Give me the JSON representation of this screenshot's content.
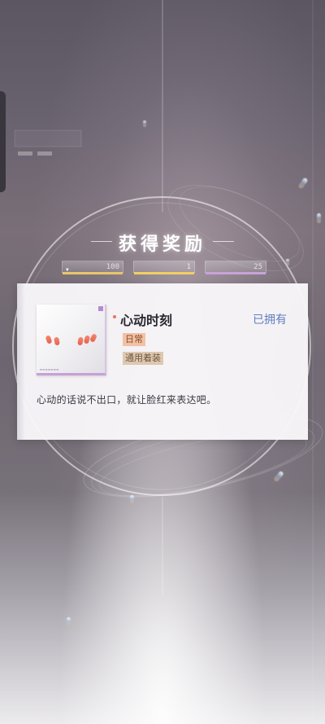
{
  "reward_panel": {
    "title": "获得奖励",
    "status_slots": [
      "100",
      "1",
      "25"
    ]
  },
  "item": {
    "name": "心动时刻",
    "owned_label": "已拥有",
    "tags": [
      "日常",
      "通用着装"
    ],
    "description": "心动的话说不出口，就让脸红来表达吧。"
  },
  "colors": {
    "owned_text": "#5f7fbf",
    "tag_daily_bg": "#f2c2a5",
    "tag_wear_bg": "#ddc8b0",
    "nail_color": "#ef7460",
    "thumb_border": "#c7a0d8"
  }
}
